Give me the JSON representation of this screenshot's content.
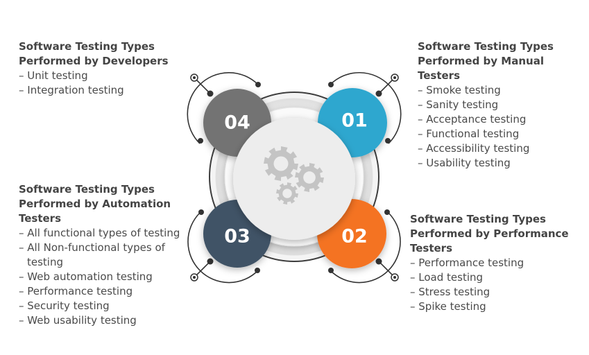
{
  "blocks": {
    "developers": {
      "title_line1": "Software Testing Types",
      "title_line2": "Performed by Developers",
      "items": [
        "Unit testing",
        "Integration testing"
      ]
    },
    "manual": {
      "title_line1": "Software Testing Types",
      "title_line2": "Performed by Manual Testers",
      "items": [
        "Smoke testing",
        "Sanity testing",
        "Acceptance testing",
        "Functional testing",
        "Accessibility testing",
        "Usability testing"
      ]
    },
    "automation": {
      "title_line1": "Software Testing Types",
      "title_line2": "Performed by Automation",
      "title_line3": "Testers",
      "items": [
        "All functional types of testing",
        "All Non-functional types of testing",
        "Web automation testing",
        "Performance testing",
        "Security testing",
        "Web usability testing"
      ]
    },
    "performance": {
      "title_line1": "Software Testing Types",
      "title_line2": "Performed by Performance",
      "title_line3": "Testers",
      "items": [
        "Performance testing",
        "Load testing",
        "Stress testing",
        "Spike testing"
      ]
    }
  },
  "circles": {
    "c01": {
      "label": "01",
      "color": "#2ea7cf"
    },
    "c02": {
      "label": "02",
      "color": "#f47323"
    },
    "c03": {
      "label": "03",
      "color": "#3f5366"
    },
    "c04": {
      "label": "04",
      "color": "#737373"
    }
  },
  "center": {
    "icon": "gears-icon",
    "color": "#c4c4c4"
  }
}
